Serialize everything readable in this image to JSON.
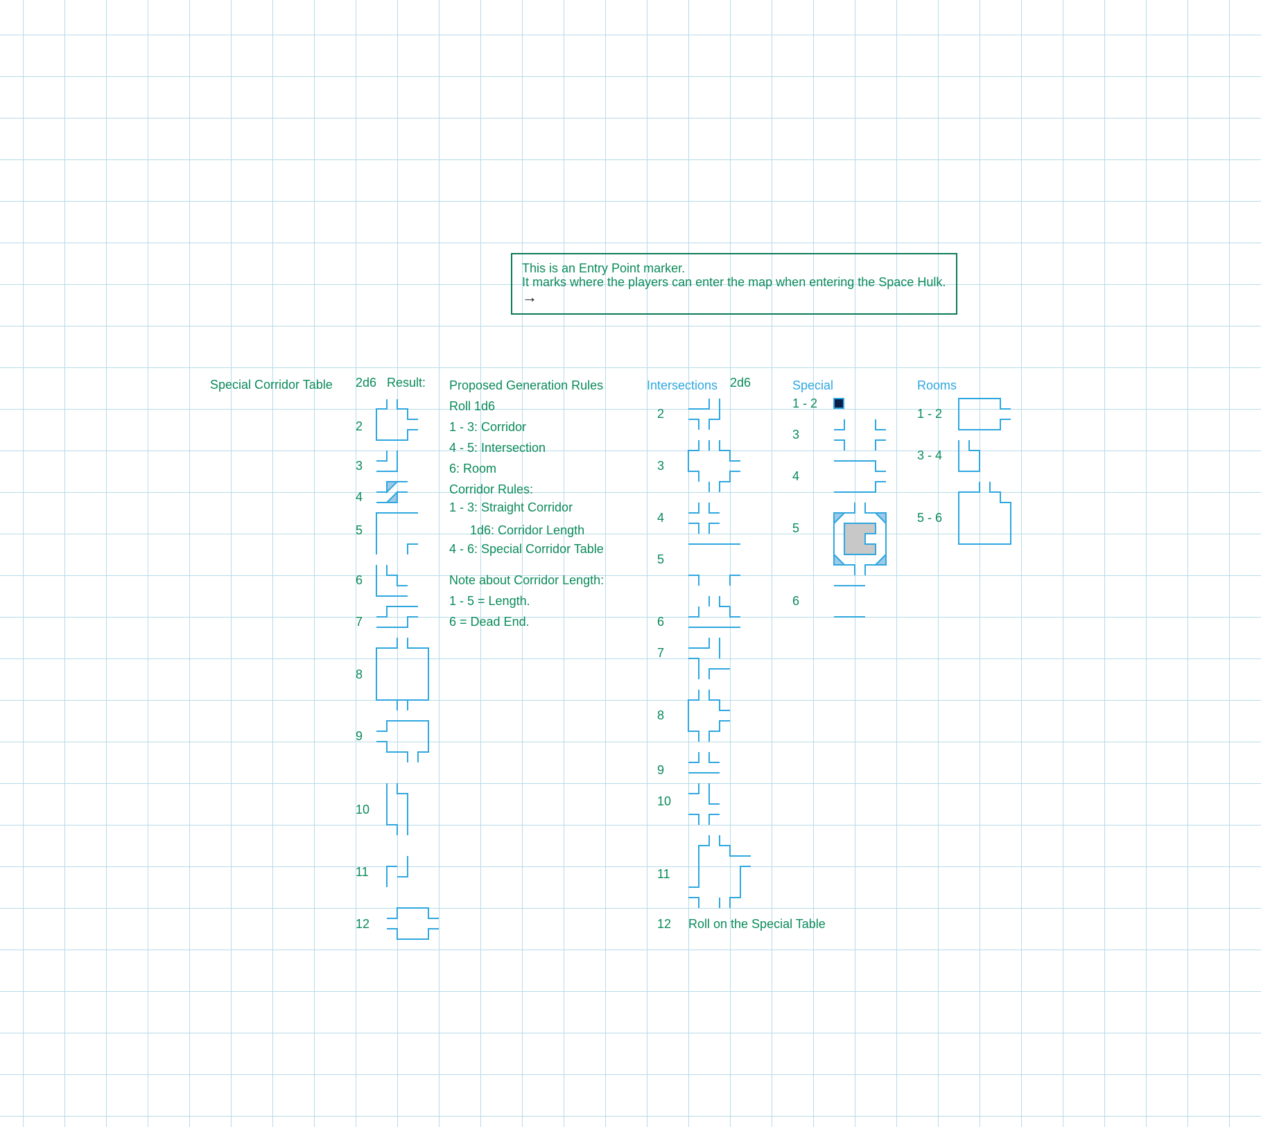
{
  "note": {
    "line1": "This is an Entry Point marker.",
    "line2": "It marks where the players can enter the map when entering the Space Hulk.",
    "arrow": "→"
  },
  "special_corridor": {
    "title": "Special Corridor Table",
    "col_dice": "2d6",
    "col_result": "Result:",
    "rows": [
      "2",
      "3",
      "4",
      "5",
      "6",
      "7",
      "8",
      "9",
      "10",
      "11",
      "12"
    ]
  },
  "rules": {
    "title": "Proposed Generation Rules",
    "lines": [
      "Roll 1d6",
      "1 - 3: Corridor",
      "4 - 5: Intersection",
      "6: Room",
      "Corridor Rules:",
      "1 - 3: Straight Corridor",
      "1d6: Corridor Length",
      "4 - 6: Special Corridor Table",
      "Note about Corridor Length:",
      "1 - 5 = Length.",
      "6 = Dead End."
    ]
  },
  "intersections": {
    "title": "Intersections",
    "col_dice": "2d6",
    "rows": [
      "2",
      "3",
      "4",
      "5",
      "6",
      "7",
      "8",
      "9",
      "10",
      "11",
      "12"
    ],
    "row12_text": "Roll on the Special Table"
  },
  "special": {
    "title": "Special",
    "rows": [
      "1 - 2",
      "3",
      "4",
      "5",
      "6"
    ]
  },
  "rooms": {
    "title": "Rooms",
    "rows": [
      "1 - 2",
      "3 - 4",
      "5 - 6"
    ]
  },
  "colors": {
    "text_green": "#0a8a5a",
    "title_blue": "#2ea7e0",
    "tile_blue": "#2ea7e0",
    "grid": "#b6dbe8",
    "fill_gray": "#c8c8c8",
    "marker_navy": "#0b1f4a"
  }
}
